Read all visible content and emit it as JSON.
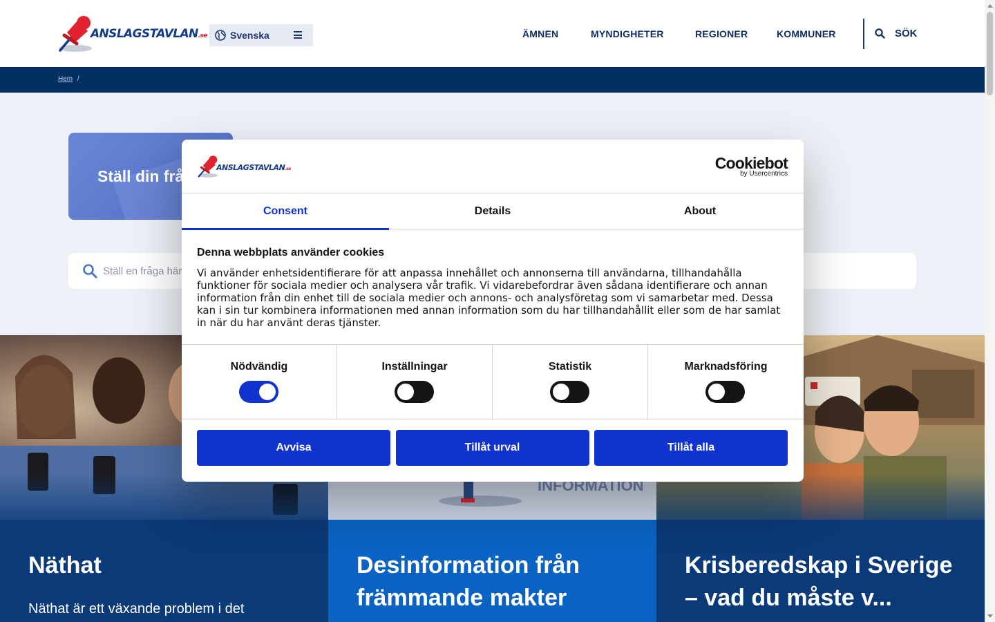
{
  "site": {
    "logo_text": "ANSLAGSTAVLAN",
    "logo_suffix": ".se",
    "language_label": "Svenska",
    "nav": [
      {
        "label": "ÄMNEN"
      },
      {
        "label": "MYNDIGHETER"
      },
      {
        "label": "REGIONER"
      },
      {
        "label": "KOMMUNER"
      }
    ],
    "search_label": "SÖK"
  },
  "breadcrumb": {
    "home": "Hem",
    "separator": "/"
  },
  "hero": {
    "ask_title": "Ställ din fråga",
    "search_placeholder": "Ställ en fråga här"
  },
  "cards": [
    {
      "title": "Näthat",
      "excerpt": "Näthat är ett växande problem i det"
    },
    {
      "title": "Desinformation från främmande makter",
      "excerpt": ""
    },
    {
      "title": "Krisberedskap i Sverige – vad du måste v...",
      "excerpt": ""
    }
  ],
  "cookie_dialog": {
    "logo_text": "ANSLAGSTAVLAN",
    "logo_suffix": ".se",
    "provider": "Cookiebot",
    "provider_sub": "by Usercentrics",
    "tabs": [
      {
        "label": "Consent",
        "active": true
      },
      {
        "label": "Details",
        "active": false
      },
      {
        "label": "About",
        "active": false
      }
    ],
    "heading": "Denna webbplats använder cookies",
    "body": "Vi använder enhetsidentifierare för att anpassa innehållet och annonserna till användarna, tillhandahålla funktioner för sociala medier och analysera vår trafik. Vi vidarebefordrar även sådana identifierare och annan information från din enhet till de sociala medier och annons- och analysföretag som vi samarbetar med. Dessa kan i sin tur kombinera informationen med annan information som du har tillhandahållit eller som de har samlat in när du har använt deras tjänster.",
    "toggles": [
      {
        "label": "Nödvändig",
        "on": true
      },
      {
        "label": "Inställningar",
        "on": false
      },
      {
        "label": "Statistik",
        "on": false
      },
      {
        "label": "Marknadsföring",
        "on": false
      }
    ],
    "buttons": {
      "reject": "Avvisa",
      "allow_selection": "Tillåt urval",
      "allow_all": "Tillåt alla"
    }
  },
  "colors": {
    "navy": "#003063",
    "accent_blue": "#1032cf",
    "card1_body": "#0b3a78",
    "card2_body": "#0a63c2",
    "card3_body": "#0b3a78"
  }
}
